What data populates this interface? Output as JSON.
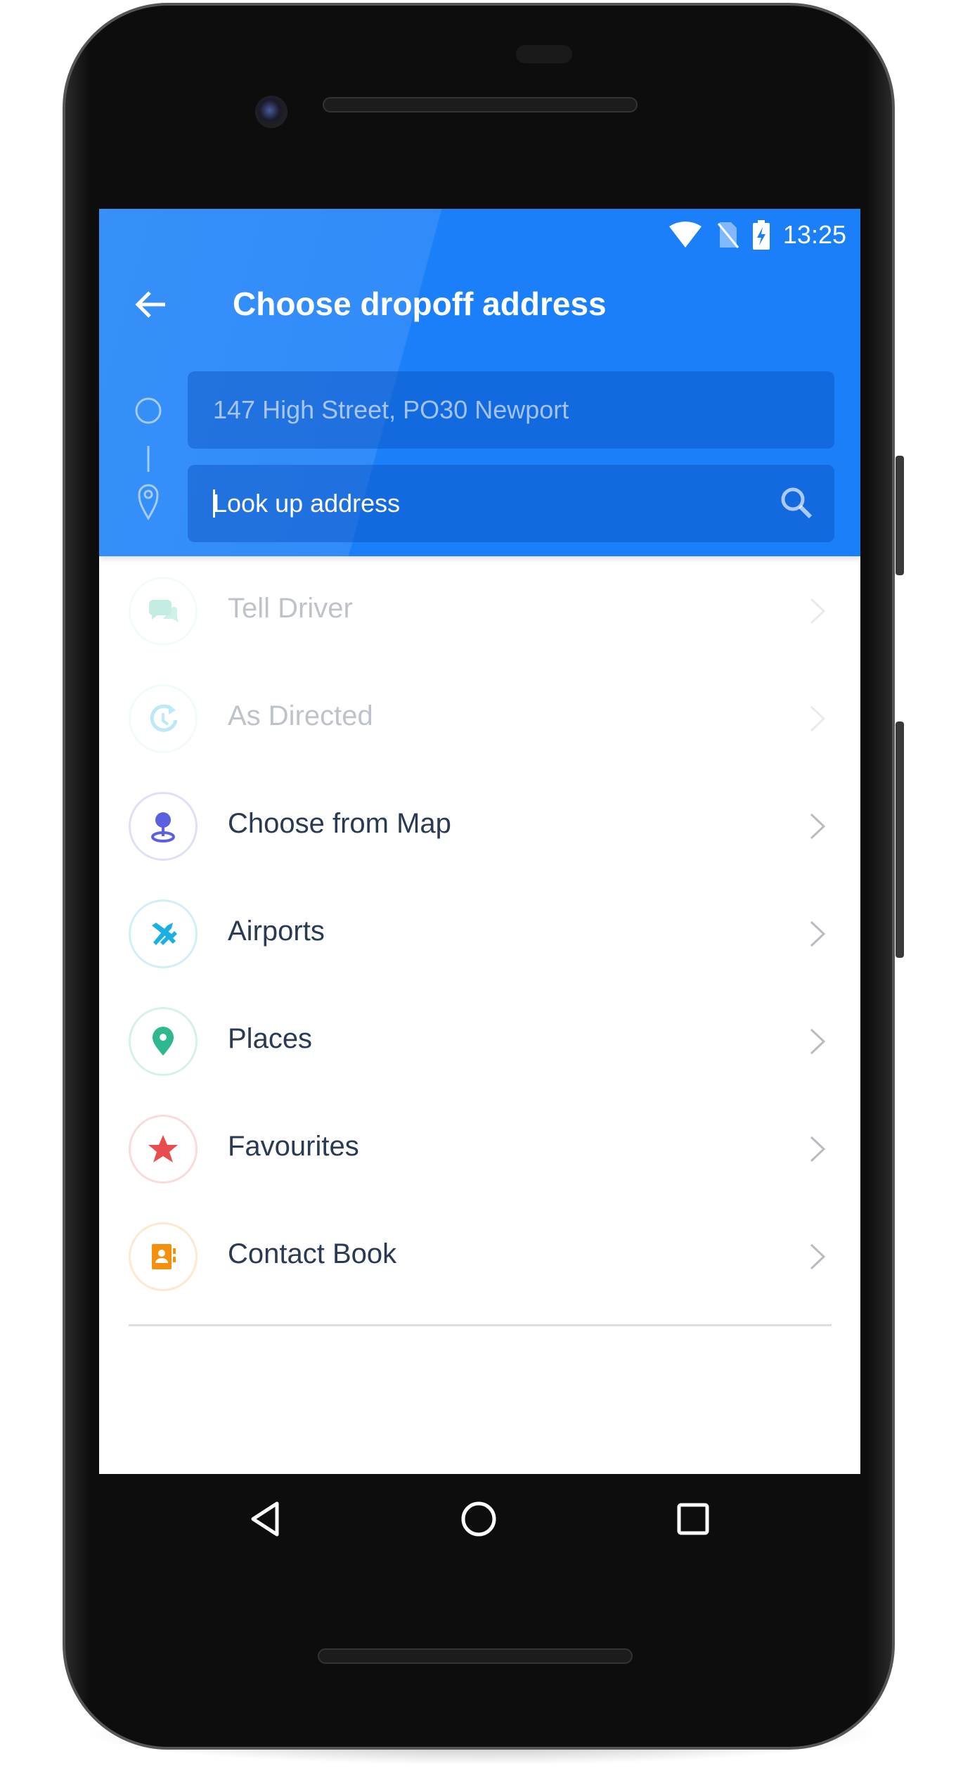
{
  "status_bar": {
    "time": "13:25",
    "icons": [
      "wifi-icon",
      "no-sim-icon",
      "battery-charging-icon"
    ]
  },
  "header": {
    "title": "Choose dropoff address",
    "back_icon": "arrow-left-icon",
    "accent": "#1a7ff8"
  },
  "pickup": {
    "value": "147 High Street, PO30 Newport"
  },
  "dropoff": {
    "value": "",
    "placeholder": "Look up address",
    "icon": "search-icon"
  },
  "options": [
    {
      "label": "Tell Driver",
      "icon": "chat-bubbles-icon",
      "color": "#3cc4a0",
      "enabled": false
    },
    {
      "label": "As Directed",
      "icon": "clock-refresh-icon",
      "color": "#29b6e6",
      "enabled": false
    },
    {
      "label": "Choose from Map",
      "icon": "map-pin-icon",
      "color": "#5a60e0",
      "enabled": true
    },
    {
      "label": "Airports",
      "icon": "airplane-icon",
      "color": "#1ab0e0",
      "enabled": true
    },
    {
      "label": "Places",
      "icon": "location-pin-icon",
      "color": "#2db890",
      "enabled": true
    },
    {
      "label": "Favourites",
      "icon": "star-icon",
      "color": "#e84c4c",
      "enabled": true
    },
    {
      "label": "Contact Book",
      "icon": "contact-book-icon",
      "color": "#f5900e",
      "enabled": true
    }
  ],
  "nav_bar": [
    "back-triangle-icon",
    "home-circle-icon",
    "recents-square-icon"
  ]
}
